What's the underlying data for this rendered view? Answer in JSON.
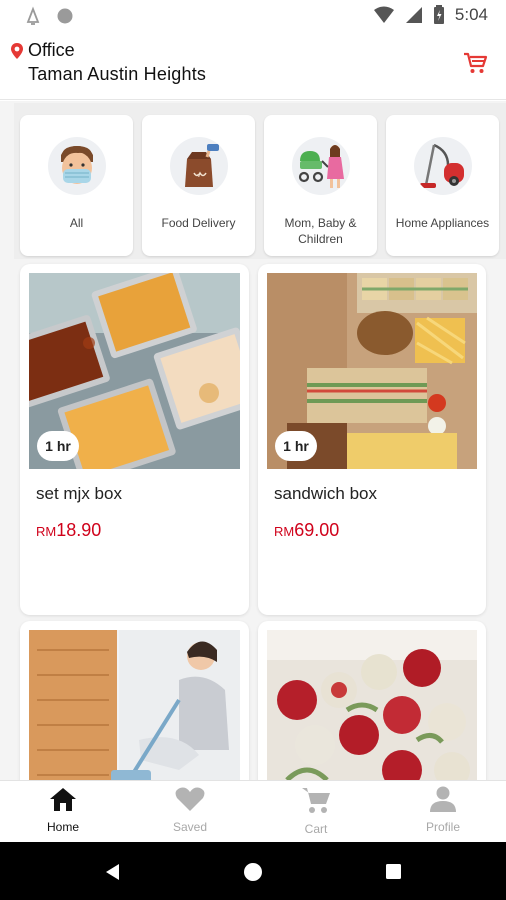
{
  "status_bar": {
    "time": "5:04"
  },
  "header": {
    "location_label": "Office",
    "address": "Taman Austin Heights"
  },
  "categories": [
    {
      "label": "All",
      "icon": "masked-person-icon"
    },
    {
      "label": "Food Delivery",
      "icon": "food-bag-icon"
    },
    {
      "label": "Mom, Baby & Children",
      "icon": "mom-stroller-icon"
    },
    {
      "label": "Home Appliances",
      "icon": "vacuum-cleaner-icon"
    }
  ],
  "products": [
    {
      "name": "set mjx box",
      "currency": "RM",
      "price": "18.90",
      "badge": "1 hr"
    },
    {
      "name": "sandwich box",
      "currency": "RM",
      "price": "69.00",
      "badge": "1 hr"
    }
  ],
  "bottom_nav": [
    {
      "label": "Home",
      "icon": "home-icon"
    },
    {
      "label": "Saved",
      "icon": "heart-icon"
    },
    {
      "label": "Cart",
      "icon": "cart-icon"
    },
    {
      "label": "Profile",
      "icon": "person-icon"
    }
  ],
  "colors": {
    "accent": "#e53935",
    "price": "#d0021b"
  }
}
